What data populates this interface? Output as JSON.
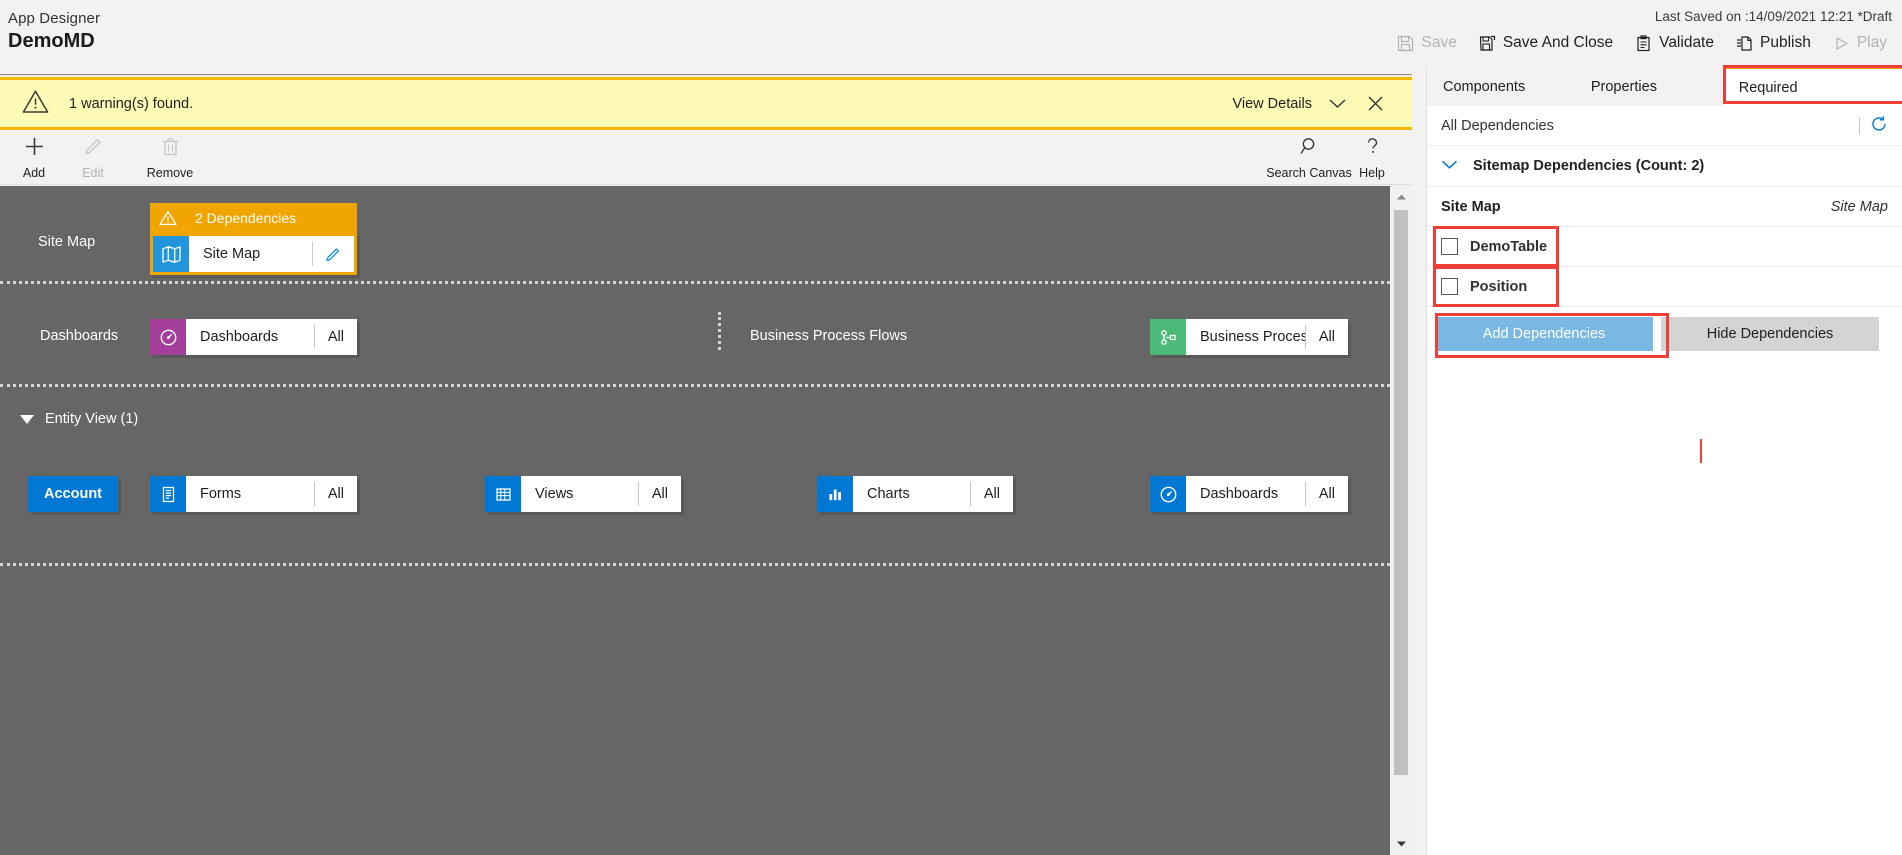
{
  "header": {
    "app_label": "App Designer",
    "app_name": "DemoMD",
    "last_saved": "Last Saved on :14/09/2021 12:21 *Draft",
    "commands": [
      {
        "label": "Save",
        "icon": "save-icon",
        "disabled": true
      },
      {
        "label": "Save And Close",
        "icon": "save-and-close-icon",
        "disabled": false
      },
      {
        "label": "Validate",
        "icon": "validate-icon",
        "disabled": false
      },
      {
        "label": "Publish",
        "icon": "publish-icon",
        "disabled": false
      },
      {
        "label": "Play",
        "icon": "play-icon",
        "disabled": true
      }
    ]
  },
  "warning": {
    "icon": "warning-triangle-icon",
    "text": "1 warning(s) found.",
    "view_details": "View Details",
    "chevron_icon": "chevron-down-icon",
    "close_icon": "close-icon",
    "bg_color": "#fdfbb6",
    "border_color": "#f5b800"
  },
  "ribbon": [
    {
      "label": "Add",
      "icon": "plus-icon",
      "disabled": false
    },
    {
      "label": "Edit",
      "icon": "pencil-icon",
      "disabled": true
    },
    {
      "label": "Remove",
      "icon": "trash-icon",
      "disabled": true
    },
    {
      "label": "Search Canvas",
      "icon": "search-icon",
      "disabled": false
    },
    {
      "label": "Help",
      "icon": "question-icon",
      "disabled": false
    }
  ],
  "canvas": {
    "bg_color": "#666666",
    "sitemap_row": {
      "label": "Site Map",
      "dependency_badge": "2 Dependencies",
      "dependency_badge_icon": "warning-triangle-icon",
      "tile": {
        "name": "Site Map",
        "icon": "sitemap-icon",
        "icon_color": "#2196dd",
        "tail": "pencil-icon"
      }
    },
    "dashboards_row": {
      "label": "Dashboards",
      "tile": {
        "name": "Dashboards",
        "icon": "dashboard-icon",
        "icon_color": "#a33f9b",
        "tail": "All"
      },
      "bpf_label": "Business Process Flows",
      "bpf_tile": {
        "name": "Business Proces...",
        "icon": "bpf-icon",
        "icon_color": "#4cbb79",
        "tail": "All"
      }
    },
    "entity_view": {
      "label": "Entity View (1)",
      "caret_icon": "caret-down-icon",
      "entity_chip": "Account",
      "tiles": [
        {
          "name": "Forms",
          "icon": "forms-icon",
          "icon_color": "#0078d4",
          "tail": "All"
        },
        {
          "name": "Views",
          "icon": "views-icon",
          "icon_color": "#0078d4",
          "tail": "All"
        },
        {
          "name": "Charts",
          "icon": "charts-icon",
          "icon_color": "#0078d4",
          "tail": "All"
        },
        {
          "name": "Dashboards",
          "icon": "dashboard-icon",
          "icon_color": "#0078d4",
          "tail": "All"
        }
      ]
    },
    "scrollbar": {
      "up_icon": "scroll-up-arrow-icon",
      "down_icon": "scroll-down-arrow-icon"
    }
  },
  "right_panel": {
    "tabs": [
      {
        "label": "Components",
        "active": false
      },
      {
        "label": "Properties",
        "active": false
      },
      {
        "label": "Required",
        "active": true,
        "highlighted": true
      }
    ],
    "all_dependencies": "All Dependencies",
    "refresh_icon": "refresh-icon",
    "section": {
      "label": "Sitemap Dependencies (Count: 2)",
      "caret_icon": "chevron-down-icon"
    },
    "group": {
      "name": "Site Map",
      "type": "Site Map"
    },
    "dependencies": [
      {
        "name": "DemoTable",
        "checked": false,
        "highlighted": true
      },
      {
        "name": "Position",
        "checked": false,
        "highlighted": true
      }
    ],
    "footer": {
      "add_label": "Add Dependencies",
      "add_disabled": true,
      "add_highlighted": true,
      "add_color": "#79b8e3",
      "hide_label": "Hide Dependencies",
      "hide_color": "#d4d4d4"
    },
    "highlight_color": "#ef3e36"
  }
}
